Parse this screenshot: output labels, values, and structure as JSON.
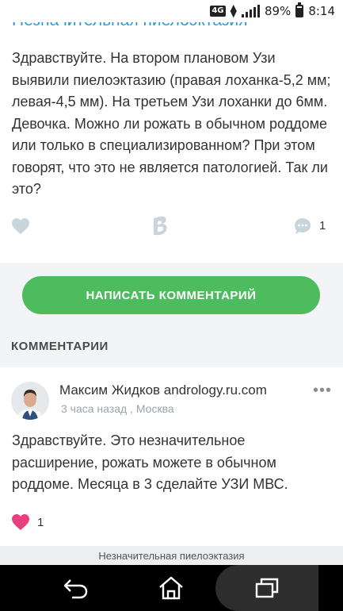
{
  "status_bar": {
    "network": "4G",
    "battery": "89%",
    "time": "8:14"
  },
  "post": {
    "title": "Незначительная пиелоэктазия",
    "body": "Здравствуйте. На втором плановом Узи выявили пиелоэктазию (правая лоханка-5,2 мм; левая-4,5 мм). На третьем Узи лоханки до 6мм. Девочка. Можно ли рожать в обычном роддоме или только в специализированном? При этом говорят, что это не является патологией. Так ли это?",
    "comment_count": "1"
  },
  "actions": {
    "write_comment_label": "НАПИСАТЬ КОММЕНТАРИЙ"
  },
  "comments_section": {
    "title": "КОММЕНТАРИИ"
  },
  "comment": {
    "author": "Максим Жидков andrology.ru.com",
    "meta": "3 часа назад , Москва",
    "text": "Здравствуйте. Это незначительное расширение, рожать можете в обычном роддоме. Месяца в 3 сделайте УЗИ МВС.",
    "likes": "1",
    "more": "•••"
  },
  "bottom_caption": "Незначительная пиелоэктазия",
  "colors": {
    "accent_blue": "#2e9ad3",
    "button_green": "#4cbc5f",
    "heart_pink": "#e8407e",
    "icon_gray": "#c9d5dd"
  },
  "icons": [
    "heart-icon",
    "b-logo-icon",
    "chat-icon",
    "back-icon",
    "home-icon",
    "recent-apps-icon"
  ]
}
